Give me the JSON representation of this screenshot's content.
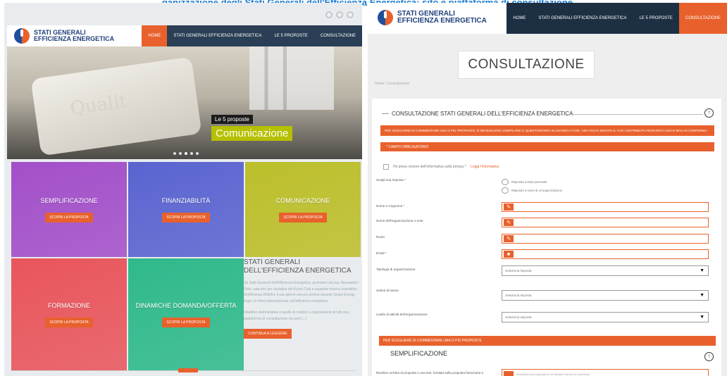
{
  "caption": "...ganizzazione degli Stati Generali dell'Efficienza Energetica: sito e piattaforma di consultazione",
  "left": {
    "brand": {
      "line1": "STATI GENERALI",
      "line2": "EFFICIENZA ENERGETICA"
    },
    "nav": [
      "HOME",
      "STATI GENERALI EFFICIENZA ENERGETICA",
      "LE 5 PROPOSTE",
      "CONSULTAZIONE"
    ],
    "hero": {
      "kicker": "Le 5 proposte",
      "title": "Comunicazione",
      "machine_text": "Qualit"
    },
    "tiles": [
      {
        "label": "SEMPLIFICAZIONE",
        "button": "SCOPRI LA PROPOSTA",
        "color": "#a34fc9"
      },
      {
        "label": "FINANZIABILITÀ",
        "button": "SCOPRI LA PROPOSTA",
        "color": "#5a64d0"
      },
      {
        "label": "COMUNICAZIONE",
        "button": "SCOPRI LA PROPOSTA",
        "color": "#bcbf2a"
      },
      {
        "label": "FORMAZIONE",
        "button": "SCOPRI LA PROPOSTA",
        "color": "#e9555c"
      },
      {
        "label": "DINAMICHE DOMANDA/OFFERTA",
        "button": "SCOPRI LA PROPOSTA",
        "color": "#2fb98b"
      }
    ],
    "intro": {
      "title": "STATI GENERALI DELL'EFFICIENZA ENERGETICA",
      "p1": "Gli Stati Generali dell'Efficienza Energetica, promotori dai Ing. Alessandro Ortis, nascono per iniziativa del Kyoto Club a supporto tecnico scientifico di efficienza ENEA e il suo giorno ancora ventiva durante Smart Energy Expo, la Fiera Internazionale sull'efficienza energetica.",
      "p2": "Obiettivo dell'iniziativa è quello di mettere a disposizione di tutti una piattaforma di consultazione via web [...]",
      "button": "CONTINUA A LEGGERE"
    }
  },
  "right": {
    "brand": {
      "line1": "STATI GENERALI",
      "line2": "EFFICIENZA ENERGETICA"
    },
    "nav": [
      "HOME",
      "STATI GENERALI EFFICIENZA ENERGETICA",
      "LE 5 PROPOSTE",
      "CONSULTAZIONE"
    ],
    "page_title": "CONSULTAZIONE",
    "breadcrumb": "Home / Consultazione",
    "form": {
      "title": "CONSULTAZIONE STATI GENERALI DELL'EFFICIENZA ENERGETICA",
      "notice": "PER SCEGLIERE DI COMMENTARE UNA O PIÙ PROPOSTE, È NECESSARIO COMPILARE IL QUESTIONARIO IN UN'UNICA FASE. UNA VOLTA INVIATO IL TUO CONTRIBUTO RICEVERAI UNA E-MAIL DI CONFERMA.",
      "required_label": "* CAMPO OBBLIGATORIO",
      "privacy_text": "Ho preso visione dell'informativa sulla privacy *",
      "privacy_link": "Leggi l'informativa",
      "choose_label": "Scegli una risposta *",
      "radio1": "Rispondo a titolo personale",
      "radio2": "Rispondo a nome di un'organizzazione",
      "fields": [
        "Nome e Cognome *",
        "Nome dell'organizzazione o ente",
        "Ruolo",
        "Email *"
      ],
      "selects": [
        {
          "label": "Tipologia di organizzazione",
          "value": "Seleziona risposta"
        },
        {
          "label": "Settori di lavoro",
          "value": "Seleziona risposta"
        },
        {
          "label": "Livello di attività dell'organizzazione",
          "value": "Seleziona risposta"
        }
      ],
      "section_bar": "PER SCEGLIERE DI COMMENTARE UNA O PIÙ PROPOSTE",
      "section_title": "SEMPLIFICAZIONE",
      "bottom_label": "Riordino un'idea di proposta o una tesi, fondata sulla proposta finanziaria e",
      "bottom_hint": "Seleziona una proposta di cui desideri fornire un contributo"
    }
  }
}
